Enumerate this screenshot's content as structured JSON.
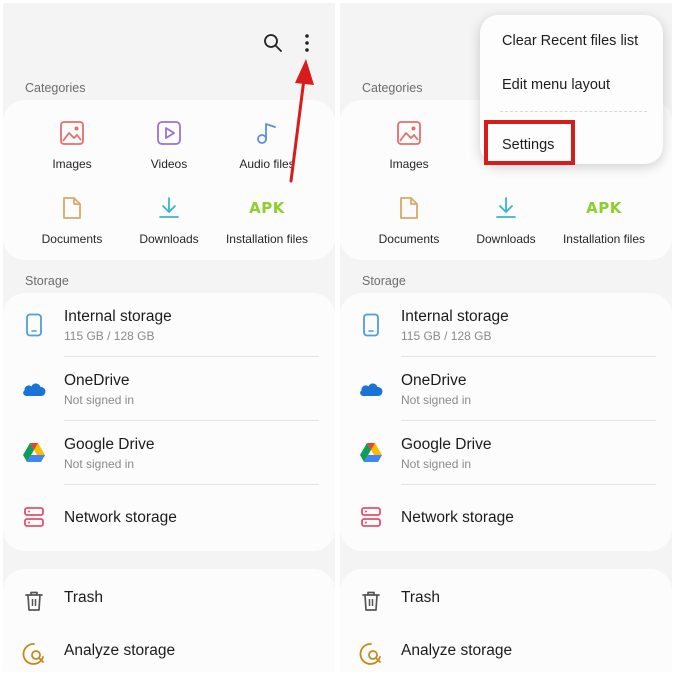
{
  "screens": [
    {
      "categories_label": "Categories",
      "categories": [
        {
          "label": "Images",
          "icon": "image-icon"
        },
        {
          "label": "Videos",
          "icon": "video-icon"
        },
        {
          "label": "Audio files",
          "icon": "audio-icon"
        },
        {
          "label": "Documents",
          "icon": "document-icon"
        },
        {
          "label": "Downloads",
          "icon": "download-icon"
        },
        {
          "label": "Installation files",
          "icon": "apk-icon",
          "icon_text": "APK"
        }
      ],
      "storage_label": "Storage",
      "storage": [
        {
          "title": "Internal storage",
          "subtitle": "115 GB / 128 GB",
          "icon": "phone-icon"
        },
        {
          "title": "OneDrive",
          "subtitle": "Not signed in",
          "icon": "onedrive-icon"
        },
        {
          "title": "Google Drive",
          "subtitle": "Not signed in",
          "icon": "google-drive-icon"
        },
        {
          "title": "Network storage",
          "subtitle": "",
          "icon": "network-storage-icon"
        }
      ],
      "tools": [
        {
          "title": "Trash",
          "icon": "trash-icon"
        },
        {
          "title": "Analyze storage",
          "icon": "analyze-storage-icon"
        }
      ]
    }
  ],
  "menu": {
    "items": [
      "Clear Recent files list",
      "Edit menu layout",
      "Settings"
    ]
  },
  "colors": {
    "annotation_red": "#d81b1b",
    "apk_green": "#8dcf2b",
    "images_icon": "#e56e6e",
    "videos_icon": "#9a72d6",
    "audio_icon": "#5b8fdc",
    "documents_icon": "#d9a86a",
    "downloads_icon": "#3ab6c9",
    "onedrive_blue": "#1a73d6",
    "network_icon": "#e2506c"
  }
}
